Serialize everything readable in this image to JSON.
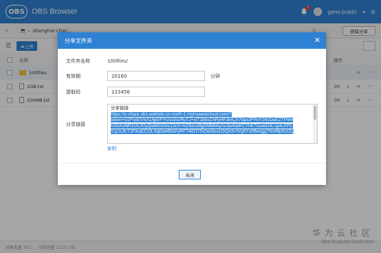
{
  "app": {
    "logo_text": "OBS",
    "title": "OBS Browser",
    "notif_count": "1",
    "account": "gens-public"
  },
  "address": {
    "path": "shanghai-char...",
    "fetch_label": "获取分享"
  },
  "toolbar": {
    "upload_label": "上传"
  },
  "table": {
    "headers": {
      "name": "名称",
      "ops": "操作"
    },
    "rows": [
      {
        "name": "100files",
        "type": "folder",
        "size": ""
      },
      {
        "name": "1GB.txt",
        "type": "file",
        "size": "00"
      },
      {
        "name": "100MB.txt",
        "type": "file",
        "size": "00"
      }
    ]
  },
  "status": {
    "count": "对象数量 301",
    "usage": "存储用量 1.521 GB"
  },
  "watermark": {
    "title": "华为云社区",
    "site": "bbs.huaweicloud.com"
  },
  "dialog": {
    "title": "分享文件夹",
    "name_label": "文件夹名称",
    "name_value": "100files/",
    "validity_label": "有效期",
    "validity_value": "20160",
    "validity_unit": "分钟",
    "code_label": "提取码",
    "code_value": "123456",
    "link_label": "分享链接",
    "link_head": "分享链接",
    "link_lines": [
      "https://e-share.obs-website.cn-north-1.myhuaweicloud.com/?",
      "token=U2FsdGVkX1/lpGFYU1x3vzRuTJ+slT1bbvZARy4PJbrLjX7tquOFRsY261OaEZTP9m",
      "hSDAsNR31fxJGyQwMmGbo13c0+Al25ersl8gSMMbhyAu3a4obKCYhKTGweG4Lsg4cXPC",
      "X1jJsJfcTJF/koECr2LSqDeM5fsPyRF74/DTtTsGw3los1GlQn5+fVg5Yx0ffwrgjg7Ns9flpRJ/Zg"
    ],
    "copy_label": "复制",
    "close_label": "关闭"
  }
}
